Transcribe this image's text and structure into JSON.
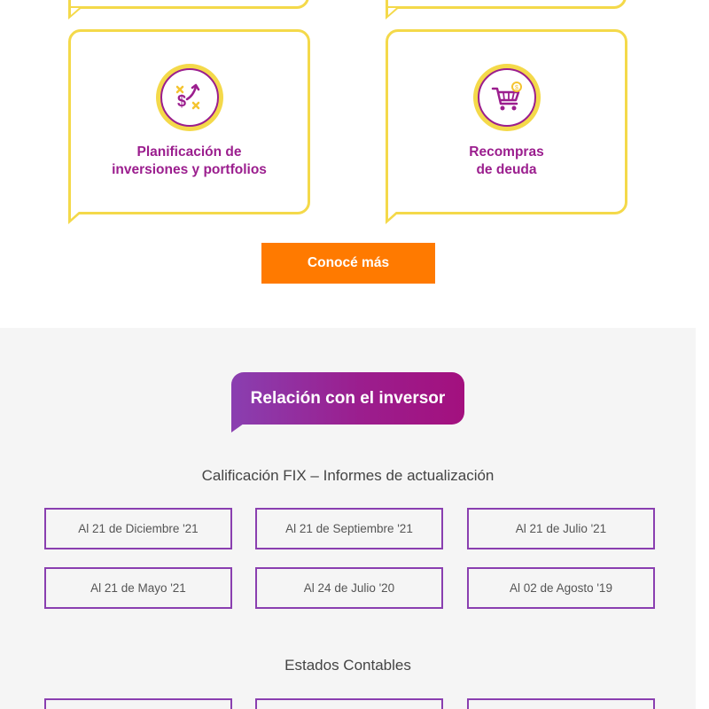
{
  "services": {
    "cards": [
      {
        "title": "Planificación de\ninversiones y portfolios",
        "icon": "investment-planning-icon"
      },
      {
        "title": "Recompras\nde deuda",
        "icon": "shopping-cart-icon"
      }
    ],
    "cta_label": "Conocé más"
  },
  "investor_relations": {
    "title": "Relación con el inversor",
    "rating_heading": "Calificación FIX – Informes de actualización",
    "rating_reports": [
      "Al 21 de Diciembre '21",
      "Al 21 de Septiembre '21",
      "Al 21 de Julio '21",
      "Al 21 de Mayo '21",
      "Al 24 de Julio '20",
      "Al 02 de Agosto '19"
    ],
    "financial_heading": "Estados Contables"
  },
  "colors": {
    "brand_purple": "#9b1e8e",
    "accent_yellow": "#f4d94a",
    "cta_orange": "#ff7a00",
    "section_gray": "#f5f5f5"
  }
}
